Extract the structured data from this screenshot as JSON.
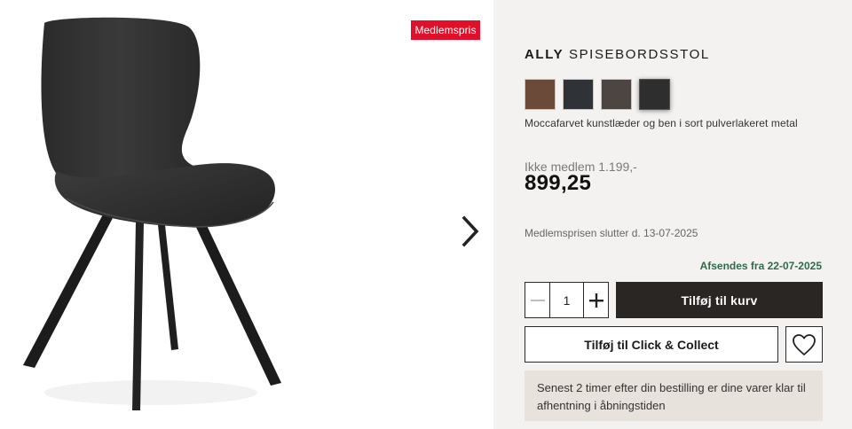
{
  "gallery": {
    "badge": "Medlemspris",
    "next_icon": "chevron-right-icon"
  },
  "product": {
    "brand": "ALLY",
    "name": "SPISEBORDSSTOL",
    "swatches": [
      {
        "name": "mocca",
        "color": "#6b4a3a"
      },
      {
        "name": "dark-grey",
        "color": "#2f3236"
      },
      {
        "name": "brown-grey",
        "color": "#4c4541"
      },
      {
        "name": "black",
        "color": "#2e2e2e"
      }
    ],
    "description": "Moccafarvet kunstlæder og ben i sort pulverlakeret metal",
    "old_price": "Ikke medlem 1.199,-",
    "price": "899,25",
    "member_end": "Medlemsprisen slutter d. 13-07-2025",
    "ships": "Afsendes fra 22-07-2025"
  },
  "actions": {
    "quantity": "1",
    "add_to_cart": "Tilføj til kurv",
    "click_collect": "Tilføj til Click & Collect",
    "wishlist_icon": "heart-icon"
  },
  "info": "Senest 2 timer efter din bestilling er dine varer klar til afhentning i åbningstiden",
  "colors": {
    "badge": "#e0102b",
    "panel_bg": "#f3f2f0",
    "cart_button": "#2a2623",
    "ships_text": "#2f6b4a",
    "info_bg": "#e8e2dd"
  }
}
